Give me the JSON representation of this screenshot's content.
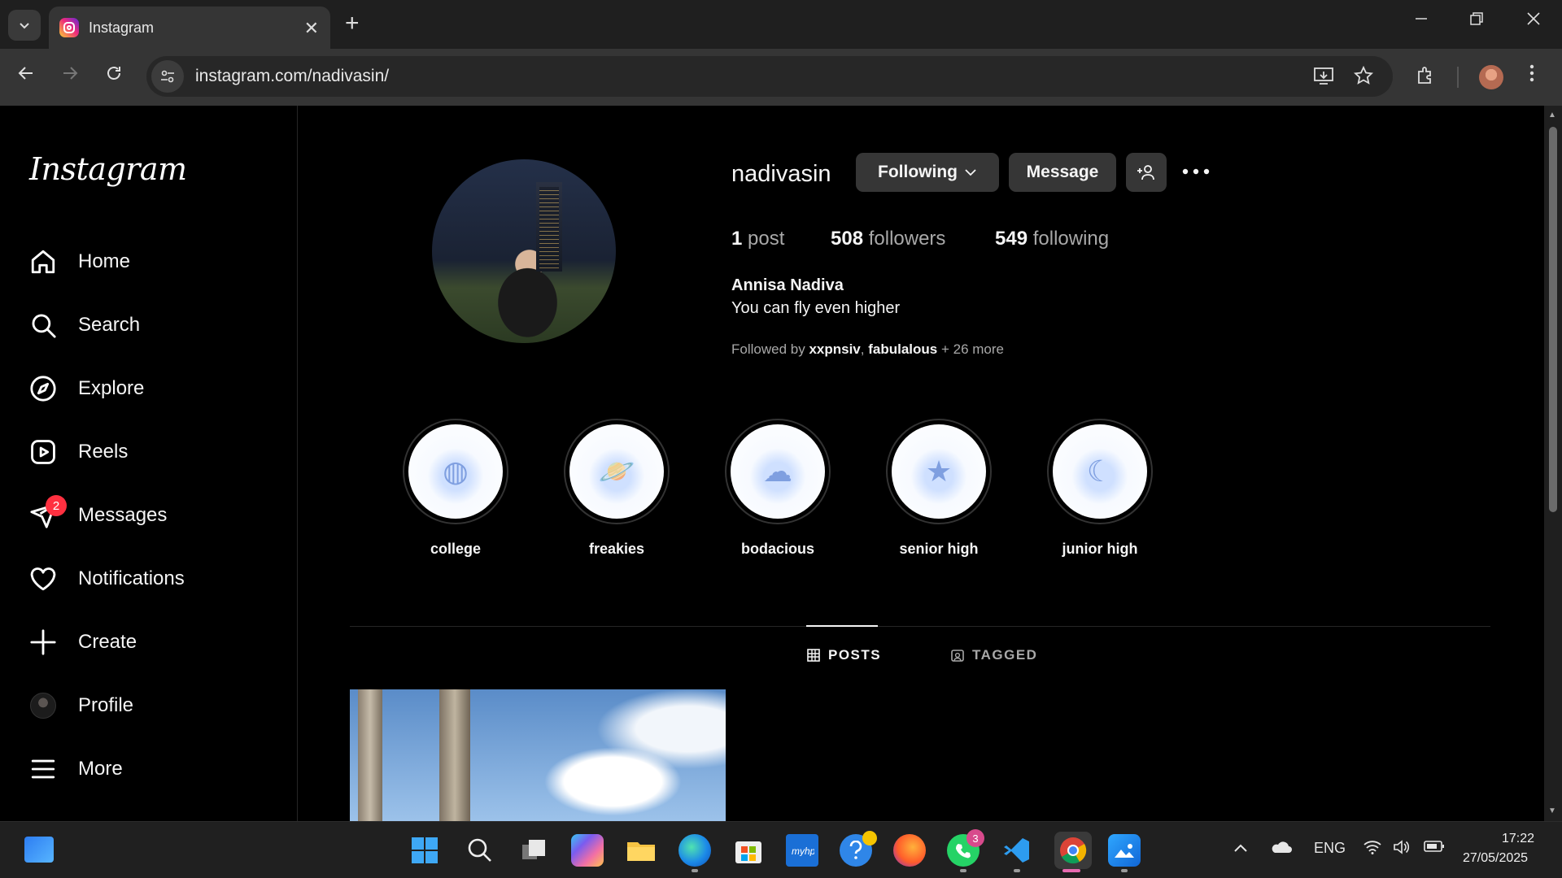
{
  "browser": {
    "tab_title": "Instagram",
    "url": "instagram.com/nadivasin/",
    "new_tab_symbol": "+",
    "close_tab_symbol": "✕"
  },
  "sidebar": {
    "logo": "Instagram",
    "items": [
      {
        "label": "Home",
        "icon": "home-icon"
      },
      {
        "label": "Search",
        "icon": "search-icon"
      },
      {
        "label": "Explore",
        "icon": "compass-icon"
      },
      {
        "label": "Reels",
        "icon": "reels-icon"
      },
      {
        "label": "Messages",
        "icon": "messenger-icon",
        "badge": "2"
      },
      {
        "label": "Notifications",
        "icon": "heart-icon"
      },
      {
        "label": "Create",
        "icon": "plus-icon"
      },
      {
        "label": "Profile",
        "icon": "avatar"
      },
      {
        "label": "More",
        "icon": "hamburger-icon"
      }
    ]
  },
  "profile": {
    "username": "nadivasin",
    "following_button": "Following",
    "message_button": "Message",
    "posts_count": "1",
    "posts_label": "post",
    "followers_count": "508",
    "followers_label": "followers",
    "following_count": "549",
    "following_label": "following",
    "full_name": "Annisa Nadiva",
    "bio": "You can fly even higher",
    "followed_by_prefix": "Followed by",
    "followed_by_user1": "xxpnsiv",
    "followed_by_sep": ",",
    "followed_by_user2": "fabulalous",
    "followed_by_more": "+ 26 more"
  },
  "highlights": [
    {
      "label": "college"
    },
    {
      "label": "freakies"
    },
    {
      "label": "bodacious"
    },
    {
      "label": "senior high"
    },
    {
      "label": "junior high"
    }
  ],
  "content_tabs": {
    "posts": "POSTS",
    "tagged": "TAGGED"
  },
  "taskbar": {
    "whatsapp_badge": "3",
    "language": "ENG",
    "time": "17:22",
    "date": "27/05/2025"
  }
}
